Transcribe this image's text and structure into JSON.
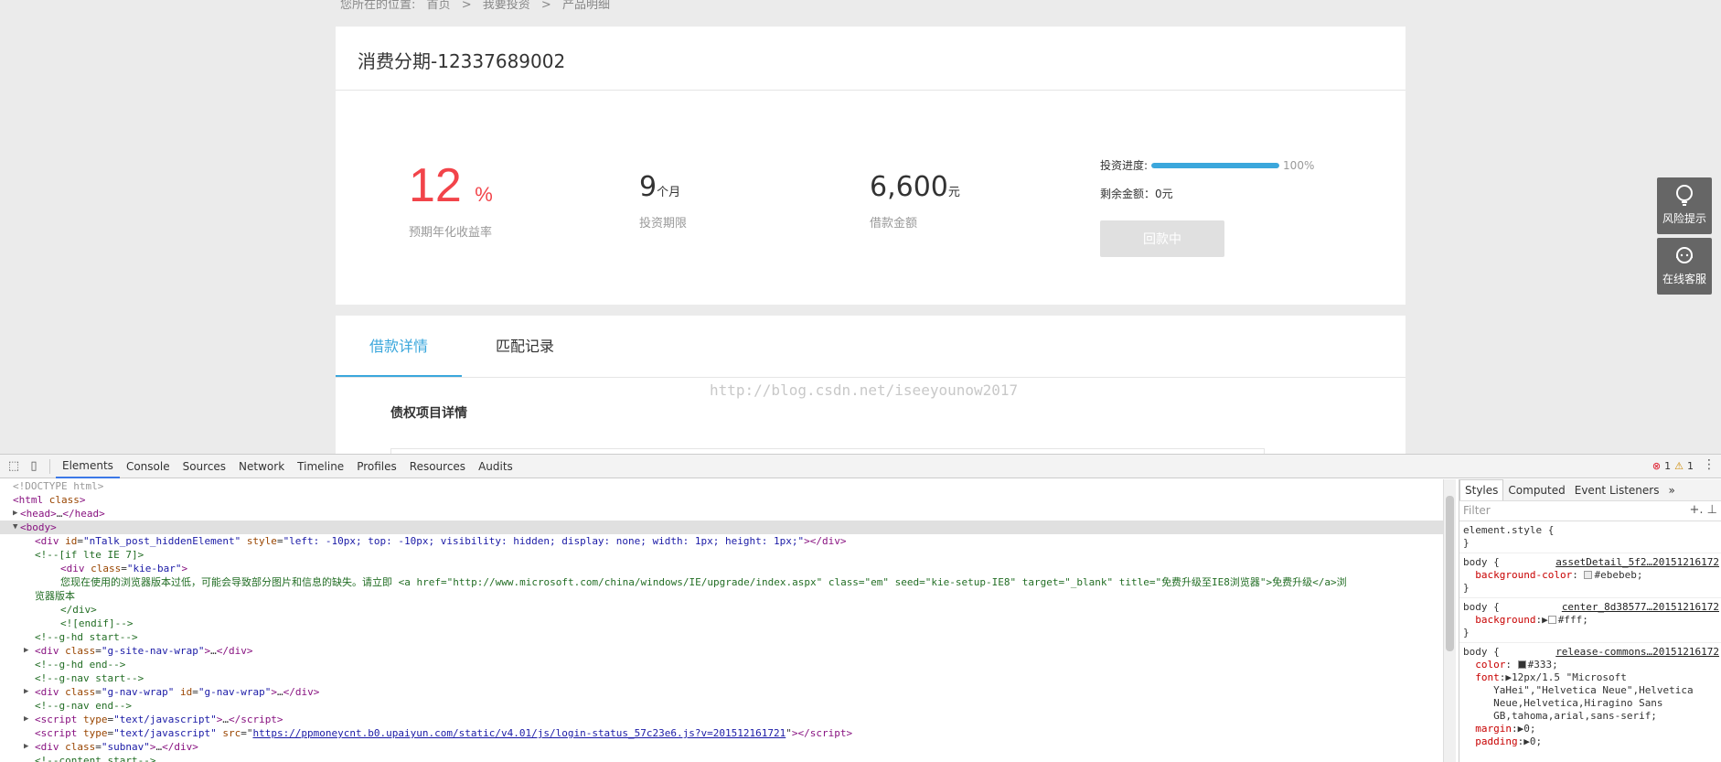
{
  "breadcrumb": {
    "prefix": "您所在的位置:",
    "items": [
      "首页",
      ">",
      "我要投资",
      ">",
      "产品明细"
    ]
  },
  "product": {
    "title": "消费分期-12337689002",
    "rate_value": "12",
    "rate_unit": "%",
    "rate_label": "预期年化收益率",
    "term_value": "9",
    "term_unit": "个月",
    "term_label": "投资期限",
    "amount_value": "6,600",
    "amount_unit": "元",
    "amount_label": "借款金额",
    "progress_label": "投资进度:",
    "progress_percent": 100,
    "progress_text": "100%",
    "remaining_text": "剩余金额：0元",
    "status_button": "回款中"
  },
  "tabs": [
    "借款详情",
    "匹配记录"
  ],
  "section_title": "债权项目详情",
  "watermark": "http://blog.csdn.net/iseeyounow2017",
  "side": {
    "risk_label": "风险提示",
    "service_label": "在线客服"
  },
  "devtools": {
    "tabs": [
      "Elements",
      "Console",
      "Sources",
      "Network",
      "Timeline",
      "Profiles",
      "Resources",
      "Audits"
    ],
    "error_count": "1",
    "warning_count": "1",
    "styles_tabs": [
      "Styles",
      "Computed",
      "Event Listeners"
    ],
    "filter_placeholder": "Filter",
    "dom": {
      "doctype": "<!DOCTYPE html>",
      "html_open": "html",
      "html_attr": "class",
      "head_tag": "head",
      "body_tag": "body",
      "div1_id": "\"nTalk_post_hiddenElement\"",
      "div1_style": "\"left: -10px; top: -10px; visibility: hidden; display: none; width: 1px; height: 1px;\"",
      "cm_if": "<!--[if lte IE 7]>",
      "kie_class": "\"kie-bar\"",
      "kie_text": "您现在使用的浏览器版本过低，可能会导致部分图片和信息的缺失。请立即 <a href=\"http://www.microsoft.com/china/windows/IE/upgrade/index.aspx\" class=\"em\" seed=\"kie-setup-IE8\" target=\"_blank\" title=\"免费升级至IE8浏览器\">免费升级</a>浏",
      "kie_text2": "览器版本",
      "div_close": "</div>",
      "cm_endif": "<![endif]-->",
      "cm_hd_start": "<!--g-hd start-->",
      "site_nav_class": "\"g-site-nav-wrap\"",
      "cm_hd_end": "<!--g-hd end-->",
      "cm_nav_start": "<!--g-nav start-->",
      "nav_class": "\"g-nav-wrap\"",
      "nav_id": "\"g-nav-wrap\"",
      "cm_nav_end": "<!--g-nav end-->",
      "script_type": "\"text/javascript\"",
      "script_src": "https://ppmoneycnt.b0.upaiyun.com/static/v4.01/js/login-status_57c23e6.js?v=201512161721",
      "subnav_class": "\"subnav\"",
      "cm_content_start": "<!--content start-->"
    },
    "styles": {
      "element_style": "element.style {",
      "rule1_selector": "body {",
      "rule1_src": "assetDetail_5f2…20151216172",
      "rule1_prop": "background-color",
      "rule1_value": "#ebebeb;",
      "rule2_selector": "body {",
      "rule2_src": "center_8d38577…20151216172",
      "rule2_prop": "background",
      "rule2_value": "#fff;",
      "rule3_selector": "body {",
      "rule3_src": "release-commons…20151216172",
      "rule3_color_prop": "color",
      "rule3_color_value": "#333;",
      "rule3_font_prop": "font",
      "rule3_font_value": "12px/1.5 \"Microsoft",
      "rule3_font_value2": "YaHei\",\"Helvetica Neue\",Helvetica",
      "rule3_font_value3": "Neue,Helvetica,Hiragino Sans",
      "rule3_font_value4": "GB,tahoma,arial,sans-serif;",
      "rule3_margin_prop": "margin",
      "rule3_margin_value": "0;",
      "rule3_padding_prop": "padding",
      "rule3_padding_value": "0;"
    }
  },
  "colors": {
    "accent": "#3ba7dc",
    "rate_red": "#f2444a",
    "page_bg": "#ebebeb",
    "side_button_bg": "#666666"
  }
}
